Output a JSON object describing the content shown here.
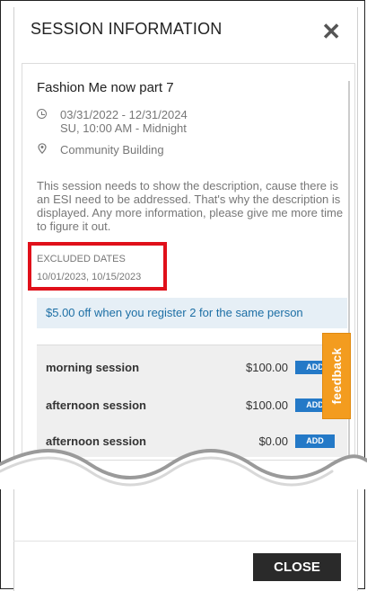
{
  "modal": {
    "title": "SESSION INFORMATION",
    "close_icon": "close-icon",
    "close_button": "CLOSE"
  },
  "session": {
    "title": "Fashion Me now part 7",
    "date_range": "03/31/2022 - 12/31/2024",
    "schedule": "SU, 10:00 AM - Midnight",
    "location": "Community Building",
    "description": "This session needs to show the description, cause there is an ESI need to be addressed. That's why the description is displayed. Any more information, please give me more time to figure it out.",
    "excluded_label": "EXCLUDED DATES",
    "excluded_value": "10/01/2023, 10/15/2023",
    "promo": "$5.00 off when you register 2 for the same person"
  },
  "options": [
    {
      "name": "morning session",
      "price": "$100.00",
      "action": "ADD"
    },
    {
      "name": "afternoon session",
      "price": "$100.00",
      "action": "ADD"
    },
    {
      "name": "afternoon session",
      "price": "$0.00",
      "action": "ADD"
    }
  ],
  "feedback": {
    "label": "feedback"
  },
  "colors": {
    "accent_blue": "#2479c7",
    "promo_bg": "#e6eff6",
    "promo_text": "#1d6fa5",
    "feedback_orange": "#f39c1f",
    "highlight_red": "#e0101a",
    "close_button_bg": "#2a2a2a"
  },
  "icons": {
    "date": "clock-icon",
    "location": "map-pin-icon"
  }
}
